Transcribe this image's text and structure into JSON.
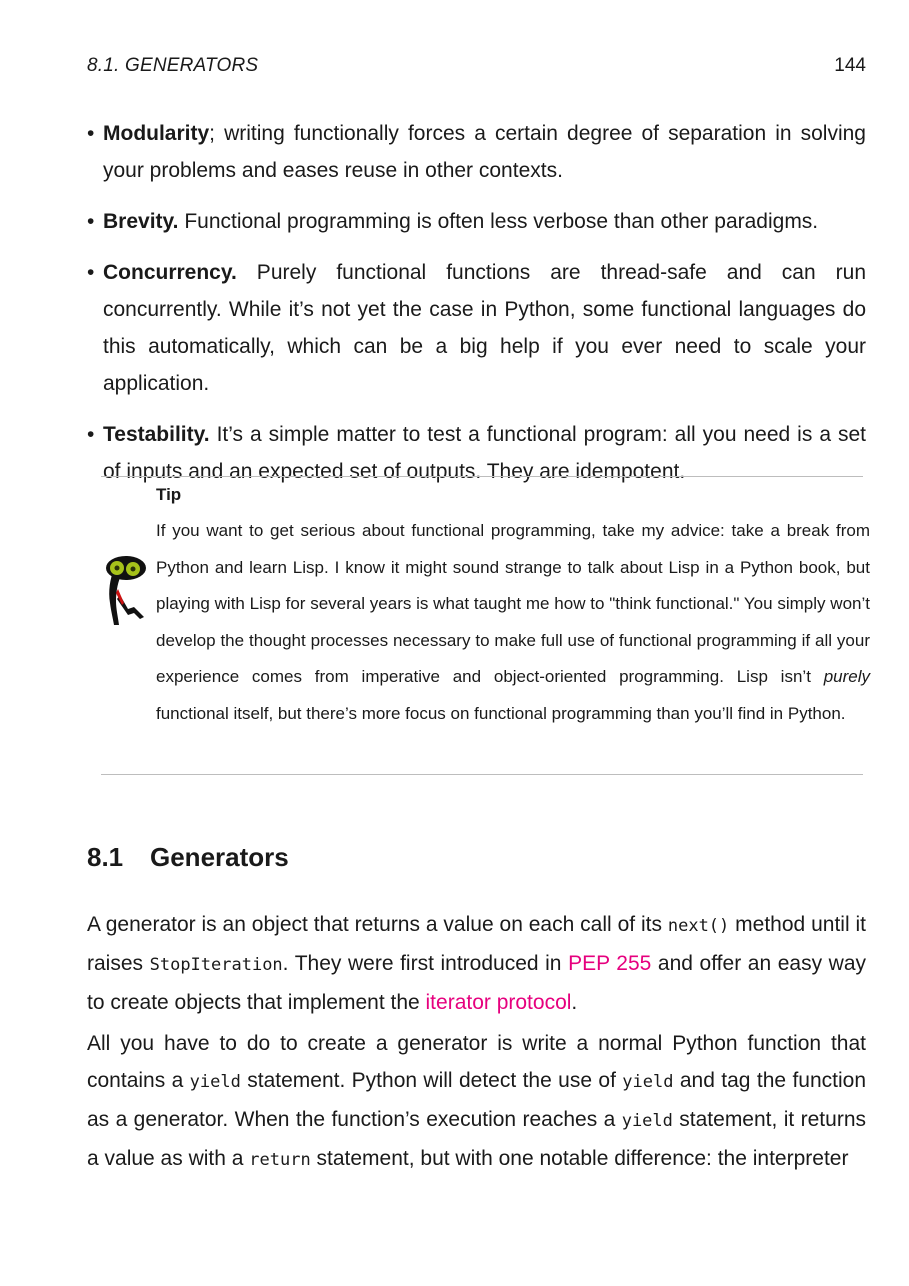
{
  "header": {
    "running_head": "8.1.  GENERATORS",
    "page_number": "144"
  },
  "bullets": [
    {
      "term": "Modularity",
      "text": "; writing functionally forces a certain degree of separation in solving your problems and eases reuse in other contexts."
    },
    {
      "term": "Brevity.",
      "text": " Functional programming is often less verbose than other paradigms."
    },
    {
      "term": "Concurrency.",
      "text": "  Purely functional functions are thread-safe and can run concurrently.  While it’s not yet the case in Python, some functional languages do this automatically, which can be a big help if you ever need to scale your application."
    },
    {
      "term": "Testability.",
      "text": " It’s a simple matter to test a functional program: all you need is a set of inputs and an expected set of outputs. They are idempotent."
    }
  ],
  "bullet_symbol": "•",
  "tip": {
    "title": "Tip",
    "icon": "snake-mascot-icon",
    "text_before": "If you want to get serious about functional programming, take my advice:  take a break from Python and learn Lisp.  I know it might sound strange to talk about Lisp in a Python book, but playing with Lisp for several years is what taught me how to \"think functional.\" You simply won’t develop the thought processes necessary to make full use of functional programming if all your experience comes from imperative and object-oriented programming.  Lisp isn’t ",
    "text_italic": "purely",
    "text_after": " functional itself, but there’s more focus on functional programming than you’ll find in Python."
  },
  "section": {
    "number": "8.1",
    "title": "Generators"
  },
  "para1": {
    "t1": "A generator is an object that returns a value on each call of its ",
    "c1": "next()",
    "t2": " method until it raises ",
    "c2": "StopIteration",
    "t3": ". They were first introduced in ",
    "link1": "PEP 255",
    "t4": " and offer an easy way to create objects that implement the ",
    "link2": "iterator protocol",
    "t5": "."
  },
  "para2": {
    "t1": "All you have to do to create a generator is write a normal Python function that contains a ",
    "c1": "yield",
    "t2": " statement. Python will detect the use of ",
    "c2": "yield",
    "t3": " and tag the function as a generator. When the function’s execution reaches a ",
    "c3": "yield",
    "t4": " statement, it returns a value as with a ",
    "c4": "return",
    "t5": " statement, but with one notable difference: the interpreter"
  },
  "colors": {
    "link": "#e6007e",
    "rule": "#bdbdbd",
    "text": "#1a1a1a"
  }
}
